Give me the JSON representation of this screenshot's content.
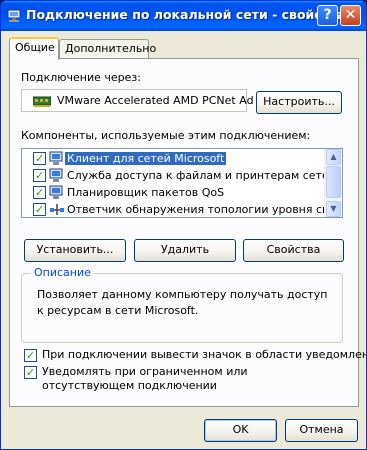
{
  "window": {
    "title": "Подключение по локальной сети - свойства",
    "help_glyph": "?",
    "close_glyph": "✕"
  },
  "tabs": [
    {
      "label": "Общие",
      "active": true
    },
    {
      "label": "Дополнительно",
      "active": false
    }
  ],
  "connect_via": {
    "label": "Подключение через:",
    "adapter": "VMware Accelerated AMD PCNet Ad",
    "configure_button": "Настроить..."
  },
  "components": {
    "label": "Компоненты, используемые этим подключением:",
    "items": [
      {
        "label": "Клиент для сетей Microsoft",
        "checked": true,
        "selected": true,
        "icon": "network-client-icon"
      },
      {
        "label": "Служба доступа к файлам и принтерам сетей Micro",
        "checked": true,
        "selected": false,
        "icon": "network-service-icon"
      },
      {
        "label": "Планировщик пакетов QoS",
        "checked": true,
        "selected": false,
        "icon": "network-service-icon"
      },
      {
        "label": "Ответчик обнаружения топологии уровня связи",
        "checked": true,
        "selected": false,
        "icon": "protocol-icon"
      }
    ],
    "buttons": {
      "install": "Установить...",
      "uninstall": "Удалить",
      "properties": "Свойства"
    }
  },
  "description": {
    "legend": "Описание",
    "text": "Позволяет данному компьютеру получать доступ к ресурсам в сети Microsoft."
  },
  "options": {
    "show_icon": {
      "label": "При подключении вывести значок в области уведомлений",
      "checked": true
    },
    "notify_limited": {
      "label": "Уведомлять при ограниченном или отсутствующем подключении",
      "checked": true
    }
  },
  "footer": {
    "ok": "OK",
    "cancel": "Отмена"
  },
  "colors": {
    "title_bar": "#0055ea",
    "selection": "#316ac5",
    "group_legend": "#0046d5"
  }
}
